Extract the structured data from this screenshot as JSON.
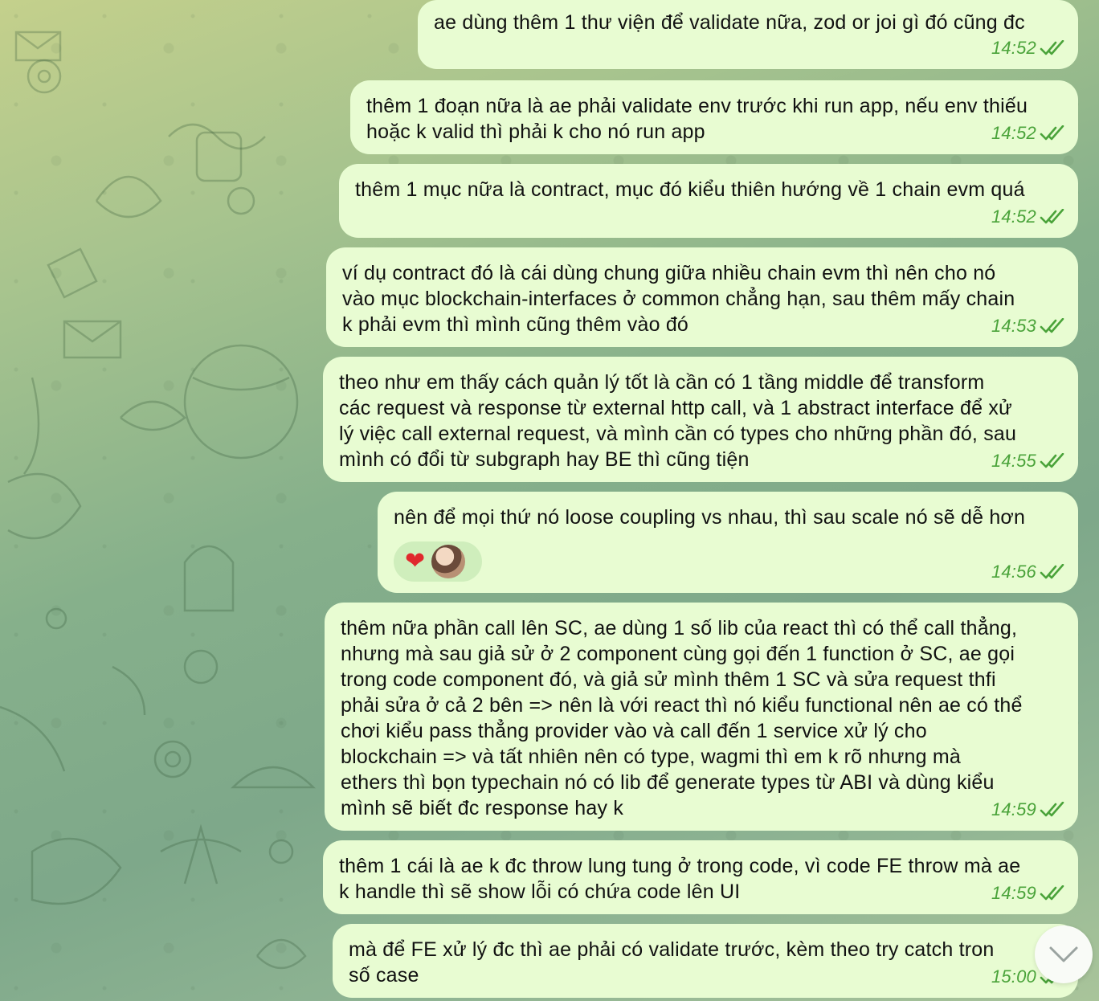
{
  "messages": [
    {
      "text": "ae dùng thêm 1 thư viện để validate nữa, zod or joi gì đó cũng đc",
      "time": "14:52"
    },
    {
      "text": "thêm 1 đoạn nữa là ae phải validate env trước khi run app, nếu env thiếu\nhoặc k valid thì phải k cho nó run app",
      "time": "14:52"
    },
    {
      "text": "thêm 1 mục nữa là contract, mục đó kiểu thiên hướng về 1 chain evm quá",
      "time": "14:52"
    },
    {
      "text": "ví dụ contract đó là cái dùng chung giữa nhiều chain evm thì nên cho nó\nvào mục blockchain-interfaces ở common chẳng hạn, sau thêm mấy chain\nk phải evm thì mình cũng thêm vào đó",
      "time": "14:53"
    },
    {
      "text": "theo như em thấy cách quản lý tốt là cần có 1 tầng middle để transform\ncác request và response từ external http call, và 1 abstract interface để xử\nlý việc call external request, và mình cần có types cho những phần đó, sau\nmình có đổi từ subgraph hay BE thì cũng tiện",
      "time": "14:55"
    },
    {
      "text": "nên để mọi thứ nó loose coupling vs nhau, thì sau scale nó sẽ dễ hơn",
      "time": "14:56",
      "reactions": {
        "emoji": "❤",
        "avatar": "reactor-avatar"
      }
    },
    {
      "text": "thêm nữa phần call lên SC, ae dùng 1 số lib của react thì có thể call thẳng,\nnhưng mà sau giả sử ở 2 component cùng gọi đến 1 function ở SC, ae gọi\ntrong code component đó, và giả sử mình thêm 1 SC và sửa request thfi\nphải sửa ở cả 2 bên => nên là với react thì nó kiểu functional nên ae có thể\nchơi kiểu pass thẳng provider vào và call đến 1 service xử lý cho\nblockchain => và tất nhiên nên có type, wagmi thì em k rõ nhưng mà\nethers thì bọn typechain nó có lib để generate types từ ABI và dùng kiểu\nmình sẽ biết đc response hay k",
      "time": "14:59"
    },
    {
      "text": "thêm 1 cái là ae k đc throw lung tung ở trong code, vì code FE throw mà ae\nk handle thì sẽ show lỗi có chứa code lên UI",
      "time": "14:59"
    },
    {
      "text": "mà để FE xử lý đc thì ae phải có validate trước, kèm theo try catch tron\nsố case",
      "time": "15:00"
    }
  ],
  "colors": {
    "bubble": "#e8fcd2",
    "meta": "#4aa33a",
    "heart": "#e0282d"
  },
  "icons": {
    "read_receipt": "double-check-icon",
    "scroll_down": "chevron-down-icon"
  }
}
